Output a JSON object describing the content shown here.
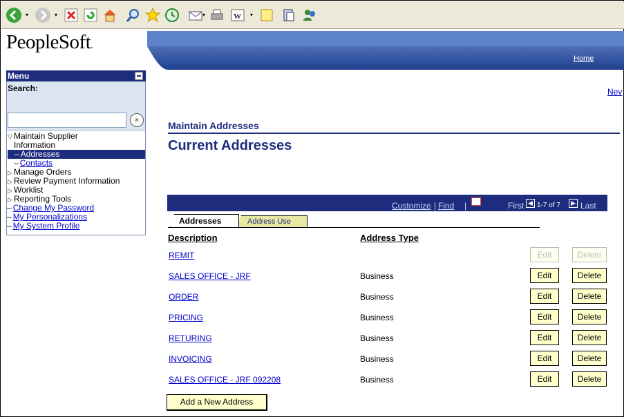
{
  "toolbar": {
    "icons": [
      "back-icon",
      "forward-icon",
      "stop-icon",
      "refresh-icon",
      "home-icon",
      "search-icon",
      "favorites-icon",
      "history-icon",
      "mail-icon",
      "print-icon",
      "edit-icon",
      "discuss-icon",
      "messenger-icon",
      "research-icon"
    ]
  },
  "header": {
    "logo": "PeopleSoft",
    "logo_mark": ".",
    "home_link": "Home",
    "new_link": "Nev"
  },
  "menu": {
    "title": "Menu",
    "search_label": "Search:",
    "search_value": "",
    "search_go": "»",
    "items": [
      {
        "label": "Maintain Supplier",
        "label2": "Information",
        "type": "group-open"
      },
      {
        "label": "Addresses",
        "type": "selected"
      },
      {
        "label": "Contacts",
        "type": "sub-link"
      },
      {
        "label": "Manage Orders",
        "type": "group-closed"
      },
      {
        "label": "Review Payment Information",
        "type": "group-closed"
      },
      {
        "label": "Worklist",
        "type": "group-closed"
      },
      {
        "label": "Reporting Tools",
        "type": "group-closed"
      },
      {
        "label": "Change My Password",
        "type": "link"
      },
      {
        "label": "My Personalizations",
        "type": "link"
      },
      {
        "label": "My System Profile",
        "type": "link"
      }
    ]
  },
  "content": {
    "breadcrumb": "Maintain Addresses",
    "title": "Current Addresses",
    "grid": {
      "customize": "Customize",
      "separator": "|",
      "find": "Find",
      "first": "First",
      "range": "1-7 of 7",
      "last": "Last"
    },
    "tabs": {
      "active": "Addresses",
      "inactive": "Address Use"
    },
    "columns": {
      "description": "Description",
      "address_type": "Address Type"
    },
    "rows": [
      {
        "description": "REMIT",
        "type": "",
        "edit": "Edit",
        "delete": "Delete"
      },
      {
        "description": "SALES OFFICE - JRF",
        "type": "Business",
        "edit": "Edit",
        "delete": "Delete"
      },
      {
        "description": "ORDER",
        "type": "Business",
        "edit": "Edit",
        "delete": "Delete"
      },
      {
        "description": "PRICING",
        "type": "Business",
        "edit": "Edit",
        "delete": "Delete"
      },
      {
        "description": "RETURING",
        "type": "Business",
        "edit": "Edit",
        "delete": "Delete"
      },
      {
        "description": "INVOICING",
        "type": "Business",
        "edit": "Edit",
        "delete": "Delete"
      },
      {
        "description": "SALES OFFICE - JRF 092208",
        "type": "Business",
        "edit": "Edit",
        "delete": "Delete"
      }
    ],
    "add_button": "Add a New Address"
  }
}
